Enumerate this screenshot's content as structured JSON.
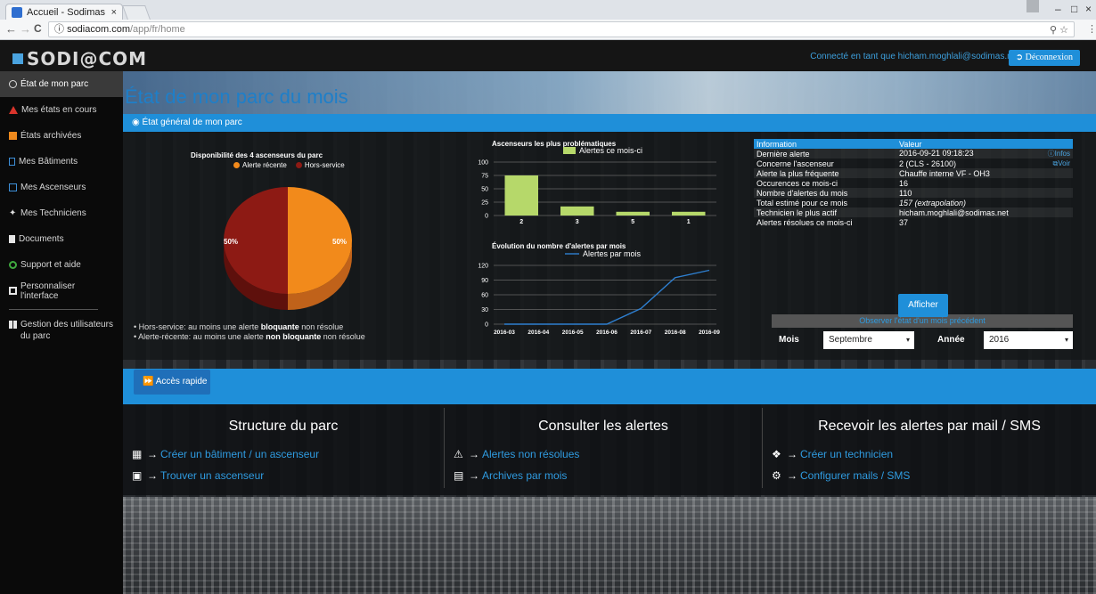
{
  "browser": {
    "tab_title": "Accueil - Sodimas",
    "tab_close": "×",
    "url_host": "sodiacom.com",
    "url_path": "/app/fr/home",
    "secure_icon": "ⓘ",
    "nav_back": "←",
    "nav_forward": "→",
    "nav_reload": "C",
    "win_min": "–",
    "win_max": "□",
    "win_close": "×"
  },
  "header": {
    "logo": "SODI@COM",
    "connected": "Connecté en tant que hicham.moghlali@sodimas.net",
    "logout": "Déconnexion"
  },
  "sidebar": {
    "items": [
      {
        "label": "État de mon parc",
        "icon": "eye-icon"
      },
      {
        "label": "Mes états en cours",
        "icon": "warning-icon"
      },
      {
        "label": "États archivées",
        "icon": "archive-icon"
      },
      {
        "label": "Mes Bâtiments",
        "icon": "building-icon"
      },
      {
        "label": "Mes Ascenseurs",
        "icon": "elevator-icon"
      },
      {
        "label": "Mes Techniciens",
        "icon": "wrench-icon"
      },
      {
        "label": "Documents",
        "icon": "document-icon"
      },
      {
        "label": "Support et aide",
        "icon": "support-icon"
      },
      {
        "label": "Personnaliser l'interface",
        "icon": "customize-icon"
      }
    ],
    "admin_item": "Gestion des utilisateurs du parc"
  },
  "main": {
    "title": "État de mon parc du mois",
    "panel_title": "État général de mon parc",
    "pie": {
      "title": "Disponibilité des 4 ascenseurs du parc",
      "legend": [
        "Alerte récente",
        "Hors-service"
      ],
      "label_left": "50%",
      "label_right": "50%",
      "note1_prefix": "Hors-service: au moins une alerte ",
      "note1_bold": "bloquante",
      "note1_suffix": " non résolue",
      "note2_prefix": "Alerte-récente: au moins une alerte ",
      "note2_bold": "non bloquante",
      "note2_suffix": " non résolue"
    },
    "quick_access": "Accès rapide",
    "columns": [
      {
        "title": "Structure du parc",
        "links": [
          {
            "label": "Créer un bâtiment / un ascenseur",
            "icon": "building-icon"
          },
          {
            "label": "Trouver un ascenseur",
            "icon": "elevator-icon"
          }
        ]
      },
      {
        "title": "Consulter les alertes",
        "links": [
          {
            "label": "Alertes non résolues",
            "icon": "warning-icon"
          },
          {
            "label": "Archives par mois",
            "icon": "archive-icon"
          }
        ]
      },
      {
        "title": "Recevoir les alertes par mail / SMS",
        "links": [
          {
            "label": "Créer un technicien",
            "icon": "wrench-icon"
          },
          {
            "label": "Configurer mails / SMS",
            "icon": "gear-icon"
          }
        ]
      }
    ],
    "arrow": "→"
  },
  "info": {
    "header": [
      "Information",
      "Valeur"
    ],
    "rows": [
      {
        "k": "Dernière alerte",
        "v": "2016-09-21 09:18:23",
        "link": "Infos"
      },
      {
        "k": "Concerne l'ascenseur",
        "v": "2 (CLS - 26100)",
        "link": "Voir"
      },
      {
        "k": "Alerte la plus fréquente",
        "v": "Chauffe interne VF - OH3"
      },
      {
        "k": "Occurences ce mois-ci",
        "v": "16"
      },
      {
        "k": "Nombre d'alertes du mois",
        "v": "110"
      },
      {
        "k": "Total estimé pour ce mois",
        "v": "157 (extrapolation)"
      },
      {
        "k": "Technicien le plus actif",
        "v": "hicham.moghlali@sodimas.net"
      },
      {
        "k": "Alertes résolues ce mois-ci",
        "v": "37"
      }
    ]
  },
  "previous": {
    "title": "Observer l'état d'un mois précédent",
    "month_label": "Mois",
    "month_value": "Septembre",
    "year_label": "Année",
    "year_value": "2016",
    "button": "Afficher"
  },
  "chart_data": [
    {
      "type": "pie",
      "title": "Disponibilité des 4 ascenseurs du parc",
      "categories": [
        "Alerte récente",
        "Hors-service"
      ],
      "values": [
        50,
        50
      ],
      "colors": [
        "#f28a1b",
        "#8d1a14"
      ]
    },
    {
      "type": "bar",
      "title": "Ascenseurs les plus problématiques",
      "series": [
        {
          "name": "Alertes ce mois-ci",
          "values": [
            75,
            17,
            7,
            7
          ]
        }
      ],
      "categories": [
        "2",
        "3",
        "5",
        "1"
      ],
      "ylim": [
        0,
        100
      ],
      "yticks": [
        0,
        25,
        50,
        75,
        100
      ],
      "color": "#b6d86a"
    },
    {
      "type": "line",
      "title": "Évolution du nombre d'alertes par mois",
      "series": [
        {
          "name": "Alertes par mois",
          "values": [
            0,
            0,
            0,
            0,
            32,
            95,
            110
          ]
        }
      ],
      "x": [
        "2016-03",
        "2016-04",
        "2016-05",
        "2016-06",
        "2016-07",
        "2016-08",
        "2016-09"
      ],
      "ylim": [
        0,
        120
      ],
      "yticks": [
        0,
        30,
        60,
        90,
        120
      ],
      "color": "#2e7fd0"
    }
  ]
}
